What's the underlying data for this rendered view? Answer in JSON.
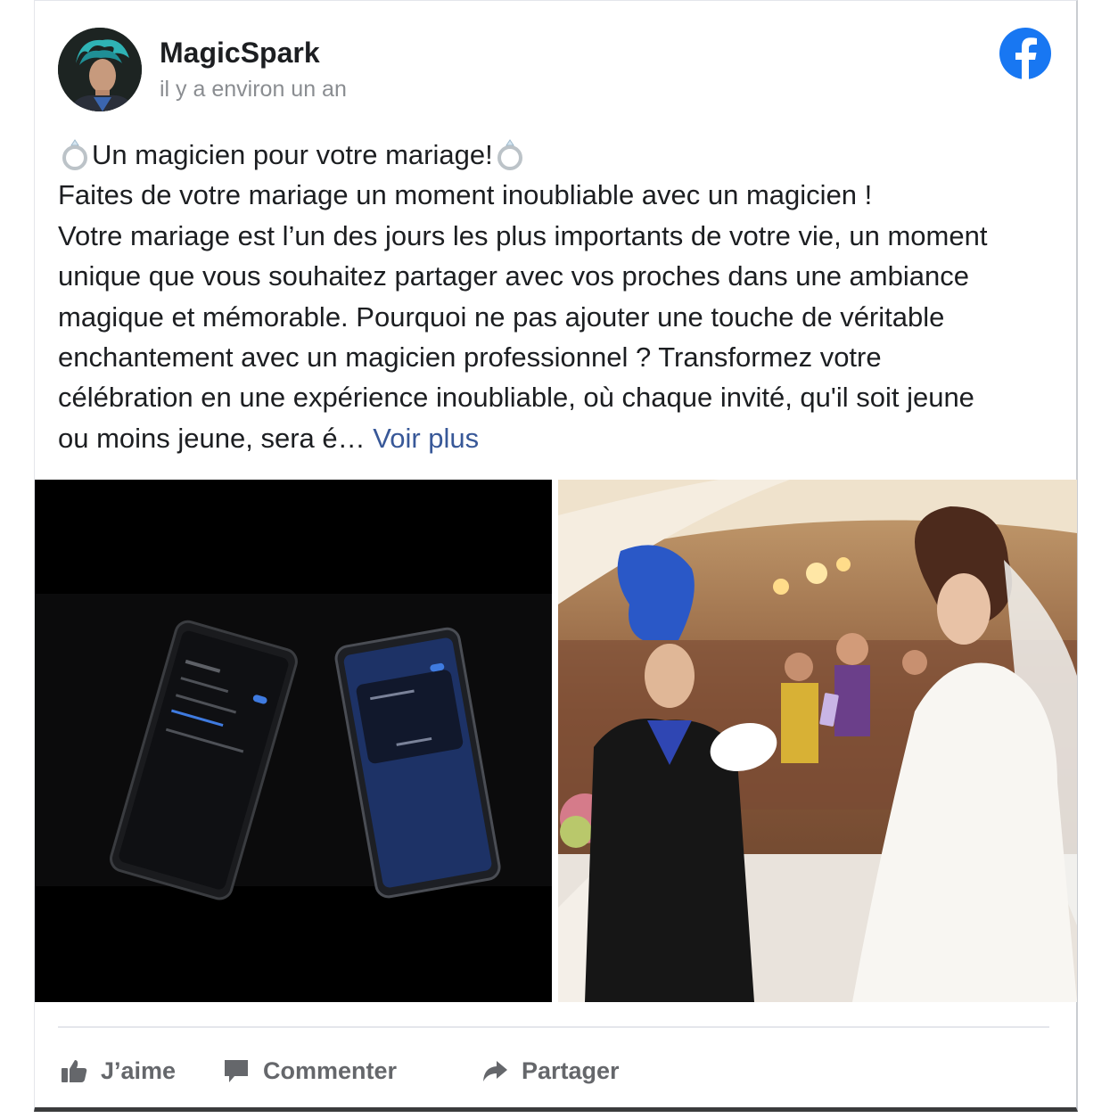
{
  "post": {
    "author": "MagicSpark",
    "timestamp": "il y a environ un an",
    "text": {
      "title": "Un magicien pour votre mariage!",
      "lines": [
        "Faites de votre mariage un moment inoubliable avec un magicien !",
        "Votre mariage est l’un des jours les plus importants de votre vie, un moment",
        "unique que vous souhaitez partager avec vos proches dans une ambiance",
        "magique et mémorable. Pourquoi ne pas ajouter une touche de véritable",
        "enchantement avec un magicien professionnel ? Transformez votre",
        "célébration en une expérience inoubliable, où chaque invité, qu'il soit jeune"
      ],
      "last_line": "ou moins jeune, sera é…",
      "see_more": "Voir plus"
    },
    "emoji_icon": "ring-icon",
    "brand_icon": "facebook-icon",
    "brand_color": "#1877f2",
    "link_color": "#385898"
  },
  "actions": {
    "like": "J’aime",
    "comment": "Commenter",
    "share": "Partager"
  }
}
